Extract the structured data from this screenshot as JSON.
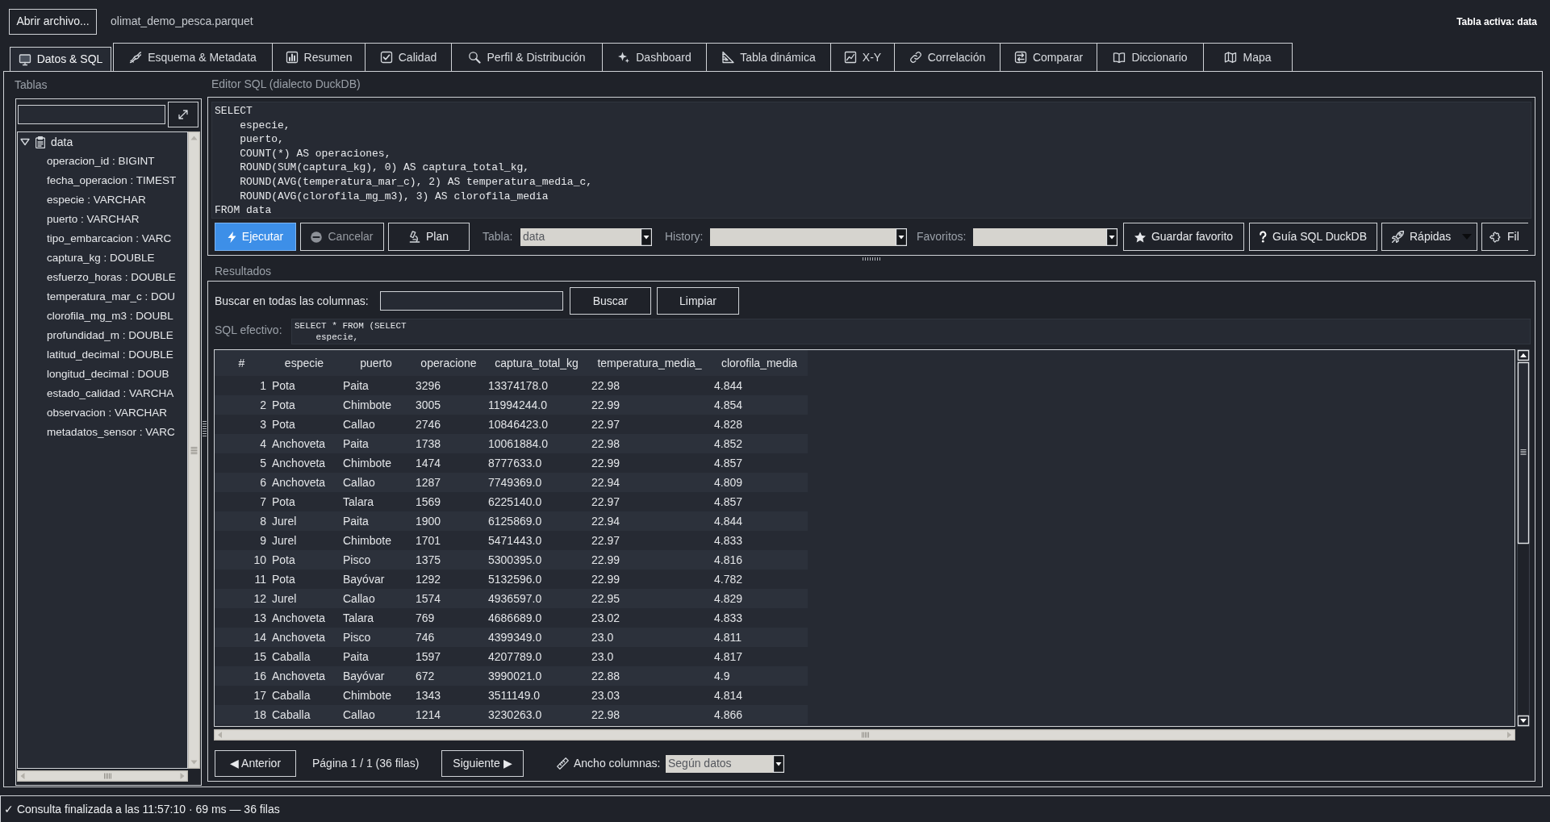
{
  "toolbar": {
    "open_button": "Abrir archivo...",
    "file_name": "olimat_demo_pesca.parquet",
    "active_table": "Tabla activa: data"
  },
  "tabs": [
    {
      "label": "Datos & SQL",
      "selected": true
    },
    {
      "label": "Esquema & Metadata",
      "selected": false
    },
    {
      "label": "Resumen",
      "selected": false
    },
    {
      "label": "Calidad",
      "selected": false
    },
    {
      "label": "Perfil & Distribución",
      "selected": false
    },
    {
      "label": "Dashboard",
      "selected": false
    },
    {
      "label": "Tabla dinámica",
      "selected": false
    },
    {
      "label": "X-Y",
      "selected": false
    },
    {
      "label": "Correlación",
      "selected": false
    },
    {
      "label": "Comparar",
      "selected": false
    },
    {
      "label": "Diccionario",
      "selected": false
    },
    {
      "label": "Mapa",
      "selected": false
    }
  ],
  "tables_panel": {
    "title": "Tablas",
    "tree": [
      {
        "label": "data",
        "expanded": true,
        "children": [
          {
            "label": "operacion_id : BIGINT"
          },
          {
            "label": "fecha_operacion : TIMEST"
          },
          {
            "label": "especie : VARCHAR"
          },
          {
            "label": "puerto : VARCHAR"
          },
          {
            "label": "tipo_embarcacion : VARC"
          },
          {
            "label": "captura_kg : DOUBLE"
          },
          {
            "label": "esfuerzo_horas : DOUBLE"
          },
          {
            "label": "temperatura_mar_c : DOU"
          },
          {
            "label": "clorofila_mg_m3 : DOUBL"
          },
          {
            "label": "profundidad_m : DOUBLE"
          },
          {
            "label": "latitud_decimal : DOUBLE"
          },
          {
            "label": "longitud_decimal : DOUB"
          },
          {
            "label": "estado_calidad : VARCHA"
          },
          {
            "label": "observacion : VARCHAR"
          },
          {
            "label": "metadatos_sensor : VARC"
          }
        ]
      }
    ]
  },
  "sql_editor": {
    "title": "Editor SQL (dialecto DuckDB)",
    "code": [
      "SELECT",
      "    especie,",
      "    puerto,",
      "    COUNT(*) AS operaciones,",
      "    ROUND(SUM(captura_kg), 0) AS captura_total_kg,",
      "    ROUND(AVG(temperatura_mar_c), 2) AS temperatura_media_c,",
      "    ROUND(AVG(clorofila_mg_m3), 3) AS clorofila_media",
      "FROM data"
    ],
    "buttons": [
      {
        "label": "Ejecutar",
        "primary": true,
        "disabled": false
      },
      {
        "label": "Cancelar",
        "primary": false,
        "disabled": true
      },
      {
        "label": "Plan",
        "primary": false,
        "disabled": false
      }
    ],
    "selectors": [
      {
        "label": "Tabla:",
        "value": "data"
      },
      {
        "label": "History:"
      },
      {
        "label": "Favoritos:"
      }
    ],
    "actions": [
      {
        "label": "Guardar favorito",
        "kind": "button"
      },
      {
        "label": "Guía SQL DuckDB",
        "kind": "button"
      },
      {
        "label": "Rápidas",
        "kind": "menu"
      },
      {
        "label": "Fil",
        "kind": "button"
      }
    ]
  },
  "results": {
    "title": "Resultados",
    "search_label": "Buscar en todas las columnas:",
    "search_buttons": [
      "Buscar",
      "Limpiar"
    ],
    "effective_sql": {
      "label": "SQL efectivo:",
      "lines": [
        "SELECT * FROM (SELECT",
        "    especie,"
      ]
    },
    "table": {
      "columns": [
        "#",
        "especie",
        "puerto",
        "operacione",
        "captura_total_kg",
        "temperatura_media_",
        "clorofila_media"
      ],
      "rows": [
        [
          "1",
          "Pota",
          "Paita",
          "3296",
          "13374178.0",
          "22.98",
          "4.844"
        ],
        [
          "2",
          "Pota",
          "Chimbote",
          "3005",
          "11994244.0",
          "22.99",
          "4.854"
        ],
        [
          "3",
          "Pota",
          "Callao",
          "2746",
          "10846423.0",
          "22.97",
          "4.828"
        ],
        [
          "4",
          "Anchoveta",
          "Paita",
          "1738",
          "10061884.0",
          "22.98",
          "4.852"
        ],
        [
          "5",
          "Anchoveta",
          "Chimbote",
          "1474",
          "8777633.0",
          "22.99",
          "4.857"
        ],
        [
          "6",
          "Anchoveta",
          "Callao",
          "1287",
          "7749369.0",
          "22.94",
          "4.809"
        ],
        [
          "7",
          "Pota",
          "Talara",
          "1569",
          "6225140.0",
          "22.97",
          "4.857"
        ],
        [
          "8",
          "Jurel",
          "Paita",
          "1900",
          "6125869.0",
          "22.94",
          "4.844"
        ],
        [
          "9",
          "Jurel",
          "Chimbote",
          "1701",
          "5471443.0",
          "22.97",
          "4.833"
        ],
        [
          "10",
          "Pota",
          "Pisco",
          "1375",
          "5300395.0",
          "22.99",
          "4.816"
        ],
        [
          "11",
          "Pota",
          "Bayóvar",
          "1292",
          "5132596.0",
          "22.99",
          "4.782"
        ],
        [
          "12",
          "Jurel",
          "Callao",
          "1574",
          "4936597.0",
          "22.95",
          "4.829"
        ],
        [
          "13",
          "Anchoveta",
          "Talara",
          "769",
          "4686689.0",
          "23.02",
          "4.833"
        ],
        [
          "14",
          "Anchoveta",
          "Pisco",
          "746",
          "4399349.0",
          "23.0",
          "4.811"
        ],
        [
          "15",
          "Caballa",
          "Paita",
          "1597",
          "4207789.0",
          "23.0",
          "4.817"
        ],
        [
          "16",
          "Anchoveta",
          "Bayóvar",
          "672",
          "3990021.0",
          "22.88",
          "4.9"
        ],
        [
          "17",
          "Caballa",
          "Chimbote",
          "1343",
          "3511149.0",
          "23.03",
          "4.814"
        ],
        [
          "18",
          "Caballa",
          "Callao",
          "1214",
          "3230263.0",
          "22.98",
          "4.866"
        ]
      ]
    },
    "pagination": {
      "previous": "◀ Anterior",
      "page_info": "Página 1 / 1 (36 filas)",
      "next": "Siguiente ▶",
      "column_width_label": "Ancho columnas:",
      "column_width_value": "Según datos"
    }
  },
  "status_bar": "✓ Consulta finalizada a las 11:57:10 · 69 ms — 36 filas"
}
